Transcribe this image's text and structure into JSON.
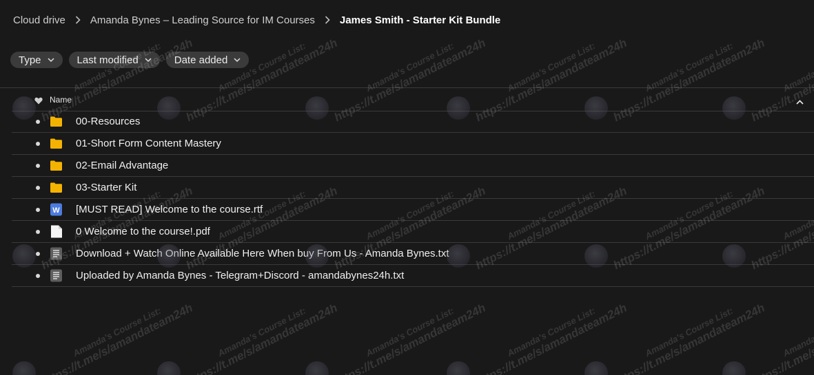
{
  "breadcrumb": {
    "items": [
      {
        "label": "Cloud drive"
      },
      {
        "label": "Amanda Bynes – Leading Source for IM Courses"
      },
      {
        "label": "James Smith - Starter Kit Bundle"
      }
    ]
  },
  "filters": [
    {
      "label": "Type"
    },
    {
      "label": "Last modified"
    },
    {
      "label": "Date added"
    }
  ],
  "table": {
    "name_header": "Name",
    "rows": [
      {
        "name": "00-Resources",
        "icon": "folder-icon"
      },
      {
        "name": "01-Short Form Content Mastery",
        "icon": "folder-icon"
      },
      {
        "name": "02-Email Advantage",
        "icon": "folder-icon"
      },
      {
        "name": "03-Starter Kit",
        "icon": "folder-icon"
      },
      {
        "name": "[MUST READ] Welcome to the course.rtf",
        "icon": "word-doc-icon"
      },
      {
        "name": "0 Welcome to the course!.pdf",
        "icon": "blank-file-icon"
      },
      {
        "name": "Download + Watch Online Available Here When buy From Us - Amanda Bynes.txt",
        "icon": "text-file-icon"
      },
      {
        "name": "Uploaded by Amanda Bynes - Telegram+Discord - amandabynes24h.txt",
        "icon": "text-file-icon"
      }
    ]
  },
  "watermark": {
    "line1": "Amanda's Course List:",
    "line2": "https://t.me/s/amandateam24h"
  },
  "colors": {
    "background": "#191919",
    "folder": "#f5b301",
    "word": "#4c7ce0",
    "chip": "#3b3b3b"
  }
}
